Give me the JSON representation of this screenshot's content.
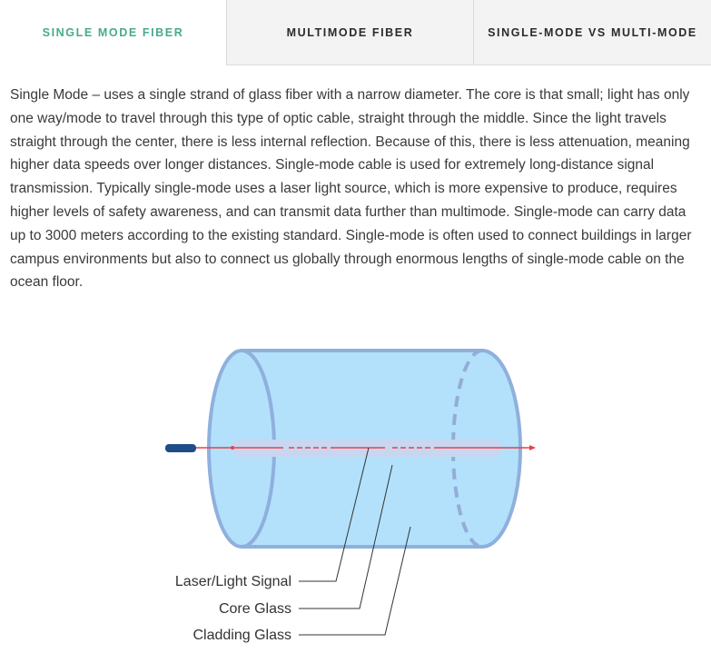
{
  "tabs": [
    {
      "label": "SINGLE MODE FIBER",
      "active": true
    },
    {
      "label": "MULTIMODE FIBER",
      "active": false
    },
    {
      "label": "SINGLE-MODE VS MULTI-MODE",
      "active": false
    }
  ],
  "content": {
    "paragraph": "Single Mode – uses a single strand of glass fiber with a narrow diameter. The core is that small; light has only one way/mode to travel through this type of optic cable, straight through the middle. Since the light travels straight through the center, there is less internal reflection. Because of this, there is less attenuation, meaning higher data speeds over longer distances. Single-mode cable is used for extremely long-distance signal transmission.  Typically single-mode uses a laser light source, which is more expensive to produce, requires higher levels of safety awareness, and can transmit data further than multimode. Single-mode can carry data up to 3000 meters according to the existing standard. Single-mode is often used to connect buildings in larger campus environments but also to connect us globally through enormous lengths of single-mode cable on the ocean floor."
  },
  "diagram": {
    "labels": {
      "laser": "Laser/Light Signal",
      "core": "Core Glass",
      "cladding": "Cladding Glass"
    }
  },
  "colors": {
    "active_tab": "#4aa88f",
    "cladding_fill": "#b3e1fb",
    "cladding_stroke": "#8fb0dd",
    "core_fill": "#c9d6f0",
    "signal": "#e8414a",
    "emitter": "#1f4d8a"
  }
}
